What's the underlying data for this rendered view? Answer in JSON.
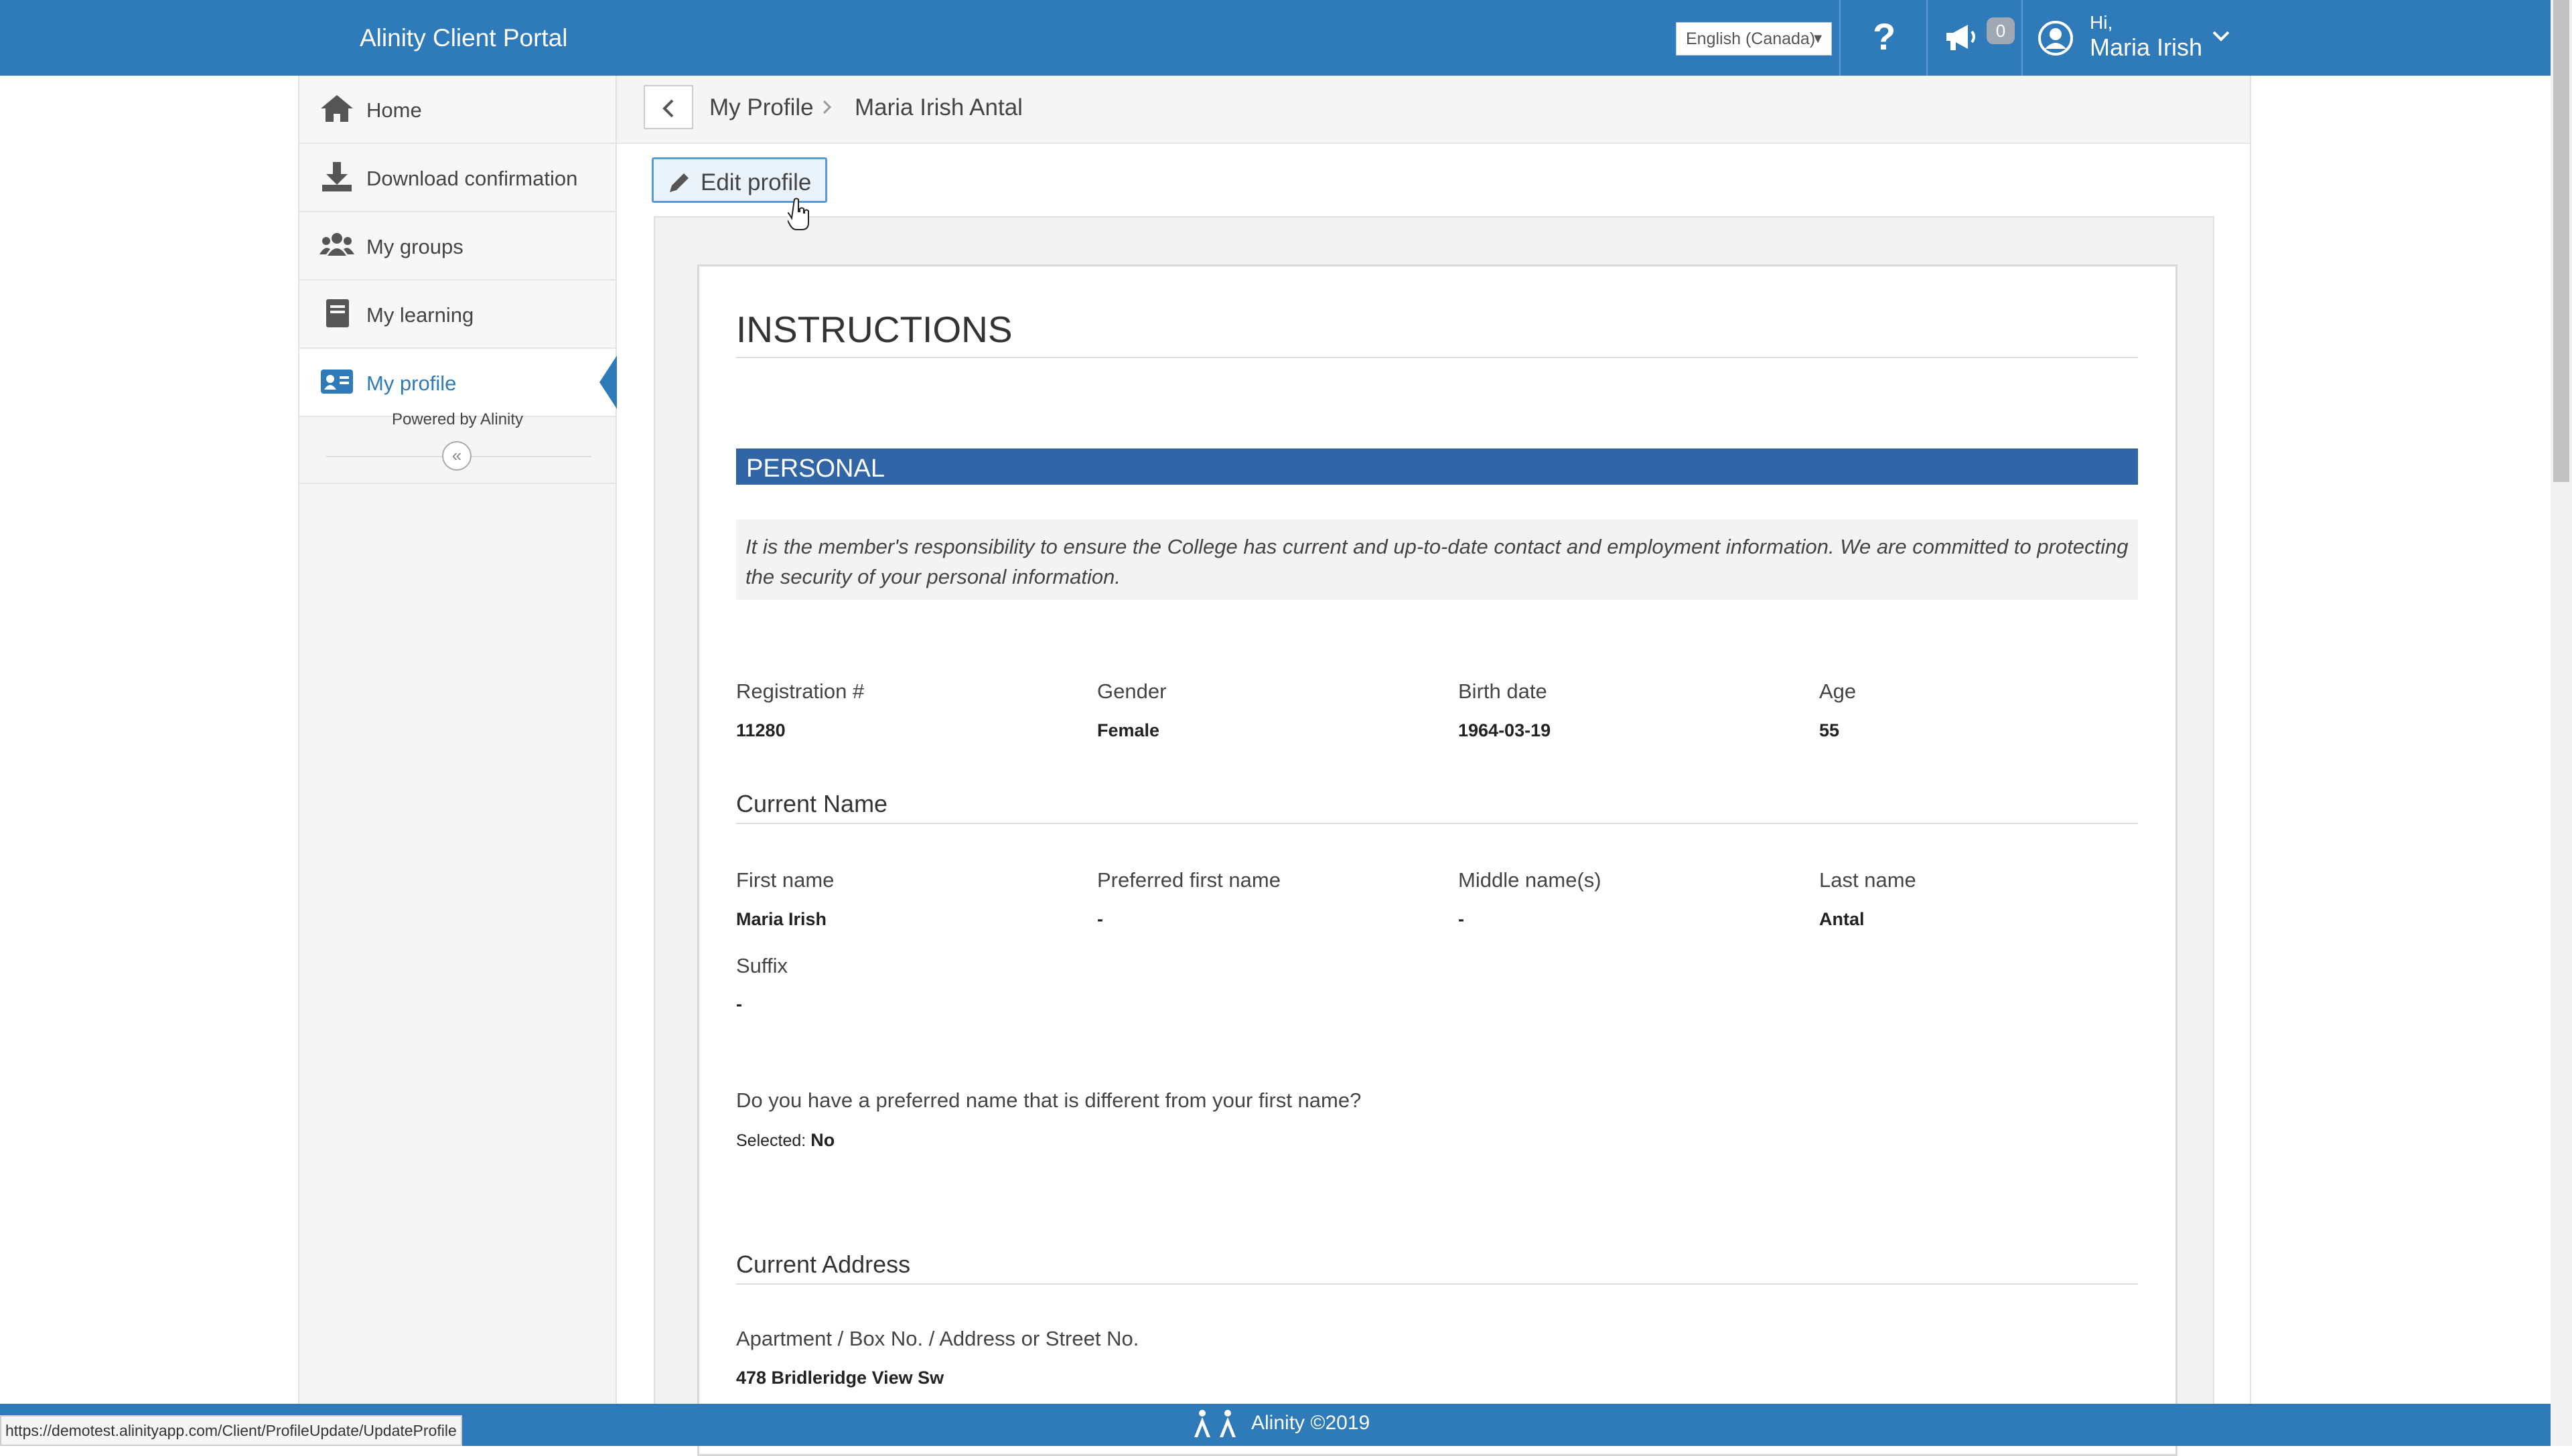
{
  "app": {
    "title": "Alinity Client Portal"
  },
  "header": {
    "language": "English (Canada)",
    "help_glyph": "?",
    "notification_count": "0",
    "greeting": "Hi,",
    "user_name": "Maria Irish"
  },
  "sidebar": {
    "items": [
      {
        "label": "Home",
        "icon": "home-icon"
      },
      {
        "label": "Download confirmation",
        "icon": "download-icon"
      },
      {
        "label": "My groups",
        "icon": "users-icon"
      },
      {
        "label": "My learning",
        "icon": "book-icon"
      },
      {
        "label": "My profile",
        "icon": "id-card-icon",
        "active": true
      }
    ],
    "powered_by": "Powered by Alinity",
    "collapse_glyph": "«"
  },
  "breadcrumb": {
    "parent": "My Profile",
    "current": "Maria Irish Antal"
  },
  "toolbar": {
    "edit_label": "Edit profile"
  },
  "profile": {
    "instructions_heading": "INSTRUCTIONS",
    "section_personal": "PERSONAL",
    "notice": "It is the member's responsibility to ensure the College has current and up-to-date contact and employment information. We are committed to protecting the security of your personal information.",
    "registration_label": "Registration #",
    "registration_value": "11280",
    "gender_label": "Gender",
    "gender_value": "Female",
    "birthdate_label": "Birth date",
    "birthdate_value": "1964-03-19",
    "age_label": "Age",
    "age_value": "55",
    "current_name_heading": "Current Name",
    "first_name_label": "First name",
    "first_name_value": "Maria Irish",
    "preferred_first_label": "Preferred first name",
    "preferred_first_value": "-",
    "middle_label": "Middle name(s)",
    "middle_value": "-",
    "last_label": "Last name",
    "last_value": "Antal",
    "suffix_label": "Suffix",
    "suffix_value": "-",
    "preferred_question": "Do you have a preferred name that is different from your first name?",
    "selected_prefix": "Selected:",
    "selected_value": "No",
    "current_address_heading": "Current Address",
    "address_label": "Apartment / Box No. / Address or Street No.",
    "address_value": "478 Bridleridge View Sw"
  },
  "footer": {
    "text": "Alinity ©2019"
  },
  "status_url": "https://demotest.alinityapp.com/Client/ProfileUpdate/UpdateProfile",
  "colors": {
    "brand": "#2f7ab9",
    "section_bar": "#3165a5",
    "sidebar_bg": "#f5f5f5"
  }
}
